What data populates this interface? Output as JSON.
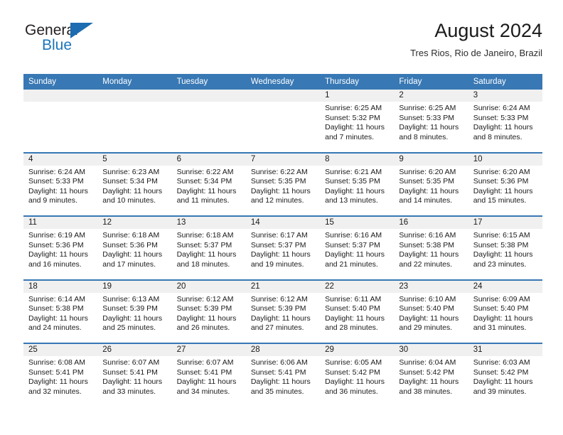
{
  "brand": {
    "word1": "General",
    "word2": "Blue",
    "flag_icon": "triangle-flag-icon",
    "color_dark": "#231f20",
    "color_blue": "#1b75bb"
  },
  "header": {
    "title": "August 2024",
    "location": "Tres Rios, Rio de Janeiro, Brazil"
  },
  "calendar": {
    "accent_color": "#3878b4",
    "daynum_bg": "#f0f0f0",
    "weekdays": [
      "Sunday",
      "Monday",
      "Tuesday",
      "Wednesday",
      "Thursday",
      "Friday",
      "Saturday"
    ],
    "labels": {
      "sunrise": "Sunrise:",
      "sunset": "Sunset:",
      "daylight": "Daylight:"
    },
    "weeks": [
      [
        {
          "day": "",
          "empty": true
        },
        {
          "day": "",
          "empty": true
        },
        {
          "day": "",
          "empty": true
        },
        {
          "day": "",
          "empty": true
        },
        {
          "day": "1",
          "sunrise": "Sunrise: 6:25 AM",
          "sunset": "Sunset: 5:32 PM",
          "daylight": "Daylight: 11 hours and 7 minutes."
        },
        {
          "day": "2",
          "sunrise": "Sunrise: 6:25 AM",
          "sunset": "Sunset: 5:33 PM",
          "daylight": "Daylight: 11 hours and 8 minutes."
        },
        {
          "day": "3",
          "sunrise": "Sunrise: 6:24 AM",
          "sunset": "Sunset: 5:33 PM",
          "daylight": "Daylight: 11 hours and 8 minutes."
        }
      ],
      [
        {
          "day": "4",
          "sunrise": "Sunrise: 6:24 AM",
          "sunset": "Sunset: 5:33 PM",
          "daylight": "Daylight: 11 hours and 9 minutes."
        },
        {
          "day": "5",
          "sunrise": "Sunrise: 6:23 AM",
          "sunset": "Sunset: 5:34 PM",
          "daylight": "Daylight: 11 hours and 10 minutes."
        },
        {
          "day": "6",
          "sunrise": "Sunrise: 6:22 AM",
          "sunset": "Sunset: 5:34 PM",
          "daylight": "Daylight: 11 hours and 11 minutes."
        },
        {
          "day": "7",
          "sunrise": "Sunrise: 6:22 AM",
          "sunset": "Sunset: 5:35 PM",
          "daylight": "Daylight: 11 hours and 12 minutes."
        },
        {
          "day": "8",
          "sunrise": "Sunrise: 6:21 AM",
          "sunset": "Sunset: 5:35 PM",
          "daylight": "Daylight: 11 hours and 13 minutes."
        },
        {
          "day": "9",
          "sunrise": "Sunrise: 6:20 AM",
          "sunset": "Sunset: 5:35 PM",
          "daylight": "Daylight: 11 hours and 14 minutes."
        },
        {
          "day": "10",
          "sunrise": "Sunrise: 6:20 AM",
          "sunset": "Sunset: 5:36 PM",
          "daylight": "Daylight: 11 hours and 15 minutes."
        }
      ],
      [
        {
          "day": "11",
          "sunrise": "Sunrise: 6:19 AM",
          "sunset": "Sunset: 5:36 PM",
          "daylight": "Daylight: 11 hours and 16 minutes."
        },
        {
          "day": "12",
          "sunrise": "Sunrise: 6:18 AM",
          "sunset": "Sunset: 5:36 PM",
          "daylight": "Daylight: 11 hours and 17 minutes."
        },
        {
          "day": "13",
          "sunrise": "Sunrise: 6:18 AM",
          "sunset": "Sunset: 5:37 PM",
          "daylight": "Daylight: 11 hours and 18 minutes."
        },
        {
          "day": "14",
          "sunrise": "Sunrise: 6:17 AM",
          "sunset": "Sunset: 5:37 PM",
          "daylight": "Daylight: 11 hours and 19 minutes."
        },
        {
          "day": "15",
          "sunrise": "Sunrise: 6:16 AM",
          "sunset": "Sunset: 5:37 PM",
          "daylight": "Daylight: 11 hours and 21 minutes."
        },
        {
          "day": "16",
          "sunrise": "Sunrise: 6:16 AM",
          "sunset": "Sunset: 5:38 PM",
          "daylight": "Daylight: 11 hours and 22 minutes."
        },
        {
          "day": "17",
          "sunrise": "Sunrise: 6:15 AM",
          "sunset": "Sunset: 5:38 PM",
          "daylight": "Daylight: 11 hours and 23 minutes."
        }
      ],
      [
        {
          "day": "18",
          "sunrise": "Sunrise: 6:14 AM",
          "sunset": "Sunset: 5:38 PM",
          "daylight": "Daylight: 11 hours and 24 minutes."
        },
        {
          "day": "19",
          "sunrise": "Sunrise: 6:13 AM",
          "sunset": "Sunset: 5:39 PM",
          "daylight": "Daylight: 11 hours and 25 minutes."
        },
        {
          "day": "20",
          "sunrise": "Sunrise: 6:12 AM",
          "sunset": "Sunset: 5:39 PM",
          "daylight": "Daylight: 11 hours and 26 minutes."
        },
        {
          "day": "21",
          "sunrise": "Sunrise: 6:12 AM",
          "sunset": "Sunset: 5:39 PM",
          "daylight": "Daylight: 11 hours and 27 minutes."
        },
        {
          "day": "22",
          "sunrise": "Sunrise: 6:11 AM",
          "sunset": "Sunset: 5:40 PM",
          "daylight": "Daylight: 11 hours and 28 minutes."
        },
        {
          "day": "23",
          "sunrise": "Sunrise: 6:10 AM",
          "sunset": "Sunset: 5:40 PM",
          "daylight": "Daylight: 11 hours and 29 minutes."
        },
        {
          "day": "24",
          "sunrise": "Sunrise: 6:09 AM",
          "sunset": "Sunset: 5:40 PM",
          "daylight": "Daylight: 11 hours and 31 minutes."
        }
      ],
      [
        {
          "day": "25",
          "sunrise": "Sunrise: 6:08 AM",
          "sunset": "Sunset: 5:41 PM",
          "daylight": "Daylight: 11 hours and 32 minutes."
        },
        {
          "day": "26",
          "sunrise": "Sunrise: 6:07 AM",
          "sunset": "Sunset: 5:41 PM",
          "daylight": "Daylight: 11 hours and 33 minutes."
        },
        {
          "day": "27",
          "sunrise": "Sunrise: 6:07 AM",
          "sunset": "Sunset: 5:41 PM",
          "daylight": "Daylight: 11 hours and 34 minutes."
        },
        {
          "day": "28",
          "sunrise": "Sunrise: 6:06 AM",
          "sunset": "Sunset: 5:41 PM",
          "daylight": "Daylight: 11 hours and 35 minutes."
        },
        {
          "day": "29",
          "sunrise": "Sunrise: 6:05 AM",
          "sunset": "Sunset: 5:42 PM",
          "daylight": "Daylight: 11 hours and 36 minutes."
        },
        {
          "day": "30",
          "sunrise": "Sunrise: 6:04 AM",
          "sunset": "Sunset: 5:42 PM",
          "daylight": "Daylight: 11 hours and 38 minutes."
        },
        {
          "day": "31",
          "sunrise": "Sunrise: 6:03 AM",
          "sunset": "Sunset: 5:42 PM",
          "daylight": "Daylight: 11 hours and 39 minutes."
        }
      ]
    ]
  }
}
